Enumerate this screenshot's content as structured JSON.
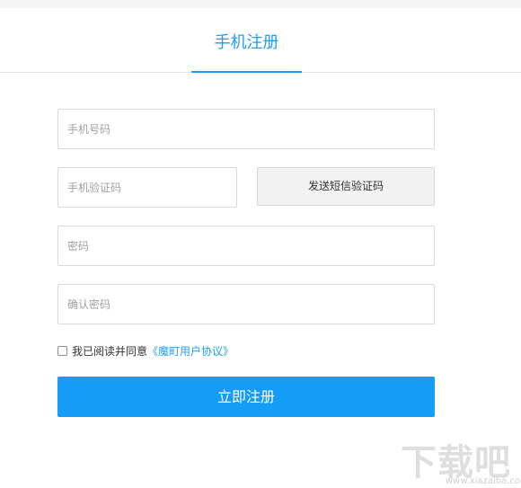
{
  "header": {
    "active_tab": "手机注册"
  },
  "form": {
    "phone_placeholder": "手机号码",
    "sms_code_placeholder": "手机验证码",
    "send_sms_button": "发送短信验证码",
    "password_placeholder": "密码",
    "confirm_password_placeholder": "确认密码",
    "agree_checked": false,
    "agree_text": "我已阅读并同意",
    "agreement_link": "《魔町用户协议》",
    "submit_button": "立即注册"
  },
  "watermark": {
    "logo_text": "下载吧",
    "site_text": "www.xiazaiba.com"
  },
  "colors": {
    "accent": "#1e9ef7",
    "button": "#159cf7"
  }
}
